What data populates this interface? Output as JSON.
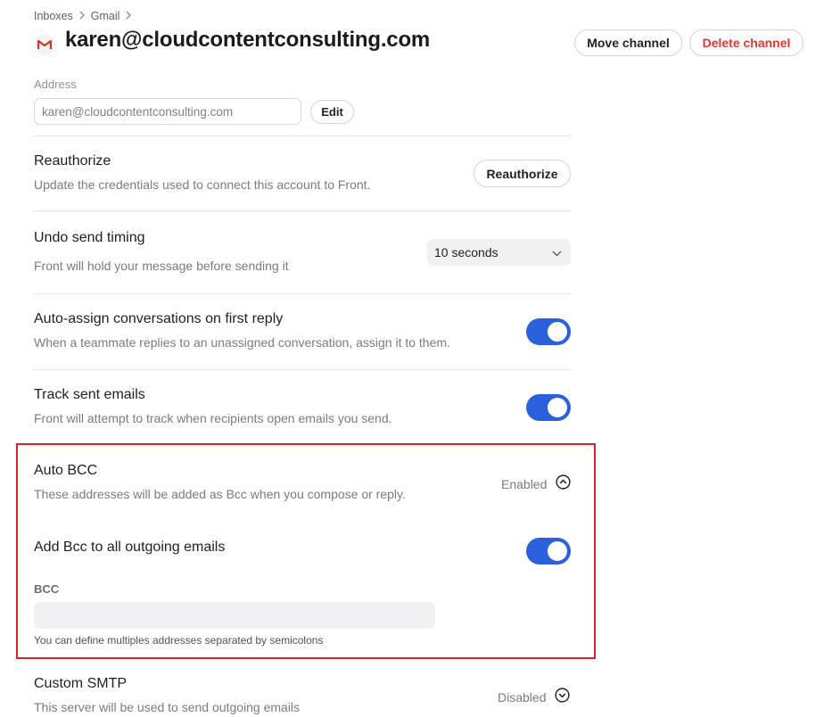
{
  "breadcrumb": {
    "items": [
      "Inboxes",
      "Gmail"
    ]
  },
  "header": {
    "title": "karen@cloudcontentconsulting.com",
    "move_label": "Move channel",
    "delete_label": "Delete channel"
  },
  "address": {
    "label": "Address",
    "value": "karen@cloudcontentconsulting.com",
    "edit_label": "Edit"
  },
  "reauthorize": {
    "title": "Reauthorize",
    "description": "Update the credentials used to connect this account to Front.",
    "button_label": "Reauthorize"
  },
  "undo_send": {
    "title": "Undo send timing",
    "description": "Front will hold your message before sending it",
    "selected": "10 seconds"
  },
  "auto_assign": {
    "title": "Auto-assign conversations on first reply",
    "description": "When a teammate replies to an unassigned conversation, assign it to them.",
    "enabled": true
  },
  "track_sent": {
    "title": "Track sent emails",
    "description": "Front will attempt to track when recipients open emails you send.",
    "enabled": true
  },
  "auto_bcc": {
    "title": "Auto BCC",
    "description": "These addresses will be added as Bcc when you compose or reply.",
    "status": "Enabled",
    "add_all_title": "Add Bcc to all outgoing emails",
    "add_all_enabled": true,
    "bcc_label": "BCC",
    "bcc_value": "",
    "hint": "You can define multiples addresses separated by semicolons"
  },
  "custom_smtp": {
    "title": "Custom SMTP",
    "description": "This server will be used to send outgoing emails",
    "status": "Disabled"
  },
  "colors": {
    "accent": "#2b60dc",
    "danger": "#e0392f",
    "highlight_border": "#d9232d"
  },
  "icons": {
    "channel": "gmail-icon",
    "crumb_separator": "chevron-right-icon",
    "select": "chevron-down-icon",
    "expanded": "chevron-up-circle-icon",
    "collapsed": "chevron-down-circle-icon"
  }
}
